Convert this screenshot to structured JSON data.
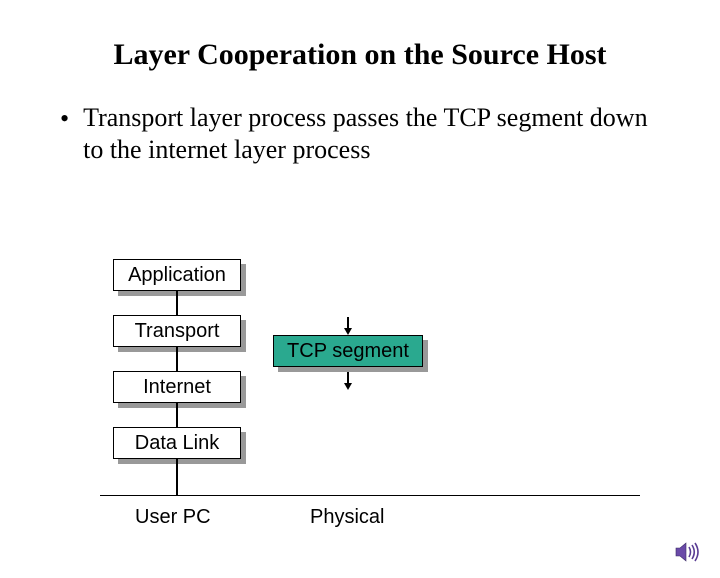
{
  "title": "Layer Cooperation on the Source Host",
  "bullet": "Transport layer process passes the TCP segment down to the internet layer process",
  "layers": {
    "application": "Application",
    "transport": "Transport",
    "internet": "Internet",
    "datalink": "Data Link"
  },
  "segment_label": "TCP segment",
  "captions": {
    "user_pc": "User PC",
    "physical": "Physical"
  },
  "icons": {
    "sound": "sound-icon"
  },
  "colors": {
    "segment_bg": "#2aa98f",
    "shadow": "#999999"
  }
}
